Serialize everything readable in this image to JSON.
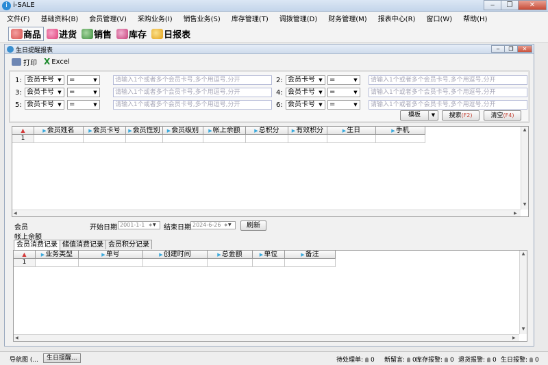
{
  "window": {
    "title": "i-SALE",
    "icon_glyph": "i"
  },
  "menu": [
    "文件(F)",
    "基础资料(B)",
    "会员管理(V)",
    "采购业务(I)",
    "销售业务(S)",
    "库存管理(T)",
    "调拨管理(D)",
    "财务管理(M)",
    "报表中心(R)",
    "窗口(W)",
    "帮助(H)"
  ],
  "toolbar": [
    {
      "label": "商品",
      "icon": "goods-icon",
      "color": "#d9534f"
    },
    {
      "label": "进货",
      "icon": "purchase-icon",
      "color": "#e0407a"
    },
    {
      "label": "销售",
      "icon": "sales-icon",
      "color": "#3f8f3f"
    },
    {
      "label": "库存",
      "icon": "inventory-icon",
      "color": "#c8407a"
    },
    {
      "label": "日报表",
      "icon": "daily-report-icon",
      "color": "#e3a21a"
    }
  ],
  "child_window": {
    "title": "生日提醒报表"
  },
  "actions": {
    "print": "打印",
    "excel_glyph": "X",
    "excel": "Excel"
  },
  "filters": [
    {
      "num": "1:",
      "field": "会员卡号",
      "op": "=",
      "placeholder": "请输入1个或者多个会员卡号,多个用逗号,分开"
    },
    {
      "num": "2:",
      "field": "会员卡号",
      "op": "=",
      "placeholder": "请输入1个或者多个会员卡号,多个用逗号,分开"
    },
    {
      "num": "3:",
      "field": "会员卡号",
      "op": "=",
      "placeholder": "请输入1个或者多个会员卡号,多个用逗号,分开"
    },
    {
      "num": "4:",
      "field": "会员卡号",
      "op": "=",
      "placeholder": "请输入1个或者多个会员卡号,多个用逗号,分开"
    },
    {
      "num": "5:",
      "field": "会员卡号",
      "op": "=",
      "placeholder": "请输入1个或者多个会员卡号,多个用逗号,分开"
    },
    {
      "num": "6:",
      "field": "会员卡号",
      "op": "=",
      "placeholder": "请输入1个或者多个会员卡号,多个用逗号,分开"
    }
  ],
  "buttons": {
    "template": "模板",
    "search": "搜索",
    "search_key": "(F2)",
    "clear": "清空",
    "clear_key": "(F4)"
  },
  "member_grid": {
    "columns": [
      "会员姓名",
      "会员卡号",
      "会员性别",
      "会员级别",
      "帐上余额",
      "总积分",
      "有效积分",
      "生日",
      "手机"
    ],
    "rows": [
      [
        "1",
        "",
        "",
        "",
        "",
        "",
        "",
        "",
        "",
        ""
      ]
    ]
  },
  "member_info": {
    "member_label": "会员",
    "balance_label": "帐上余额",
    "start_label": "开始日期",
    "start_value": "2001-1-1",
    "end_label": "结束日期",
    "end_value": "2024-6-26",
    "refresh": "刷新"
  },
  "tabs": [
    "会员消费记录",
    "储值消费记录",
    "会员积分记录"
  ],
  "record_grid": {
    "columns": [
      "业务类型",
      "单号",
      "创建时间",
      "总金额",
      "单位",
      "备注"
    ],
    "rows": [
      [
        "1",
        "",
        "",
        "",
        "",
        "",
        ""
      ]
    ]
  },
  "status": {
    "nav": "导航图 (...",
    "open_tab": "生日提醒...",
    "pending_label": "待处理单:",
    "pending": "0",
    "msg_label": "新留言:",
    "msg": "0",
    "stock_label": "库存报警:",
    "stock": "0",
    "return_label": "退货报警:",
    "return": "0",
    "birthday_label": "生日报警:",
    "birthday": "0"
  }
}
